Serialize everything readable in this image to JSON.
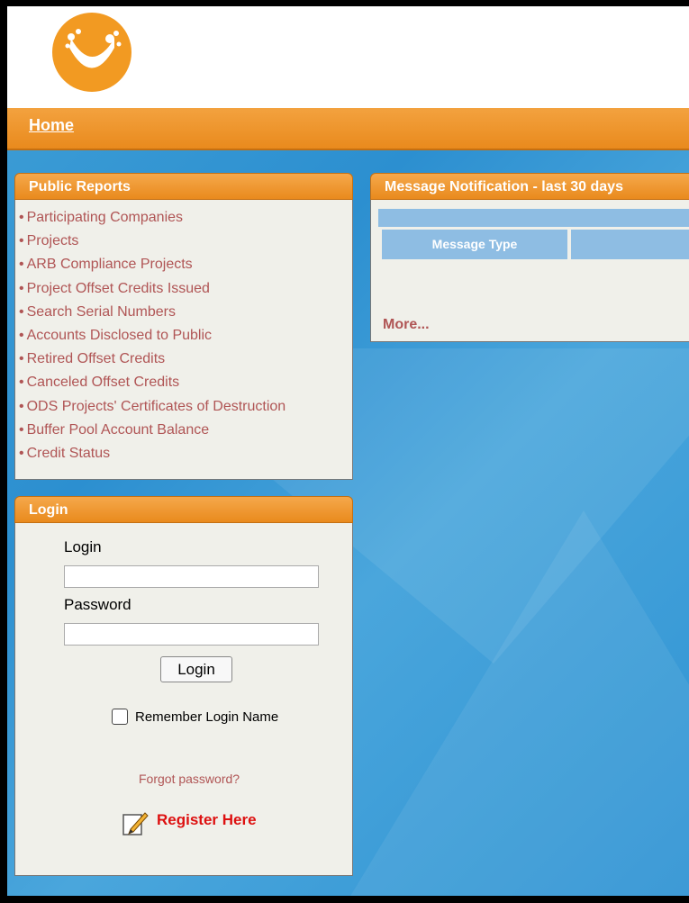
{
  "nav": {
    "home": "Home"
  },
  "public_reports": {
    "title": "Public Reports",
    "items": [
      "Participating Companies",
      "Projects",
      "ARB Compliance Projects",
      "Project Offset Credits Issued",
      "Search Serial Numbers",
      "Accounts Disclosed to Public",
      "Retired Offset Credits",
      "Canceled Offset Credits",
      "ODS Projects' Certificates of Destruction",
      "Buffer Pool Account Balance",
      "Credit Status"
    ]
  },
  "login": {
    "title": "Login",
    "login_label": "Login",
    "password_label": "Password",
    "login_value": "",
    "password_value": "",
    "button": "Login",
    "remember": "Remember Login Name",
    "forgot": "Forgot password?",
    "register": "Register Here"
  },
  "messages": {
    "title": "Message Notification - last 30 days",
    "column_message_type": "Message Type",
    "more": "More..."
  },
  "colors": {
    "accent_orange": "#e98a1d",
    "background_blue": "#3f9fd6",
    "link": "#b05555",
    "register": "#dd1010"
  },
  "icons": {
    "logo": "orange-circle-logo",
    "register": "pencil-edit-icon"
  }
}
